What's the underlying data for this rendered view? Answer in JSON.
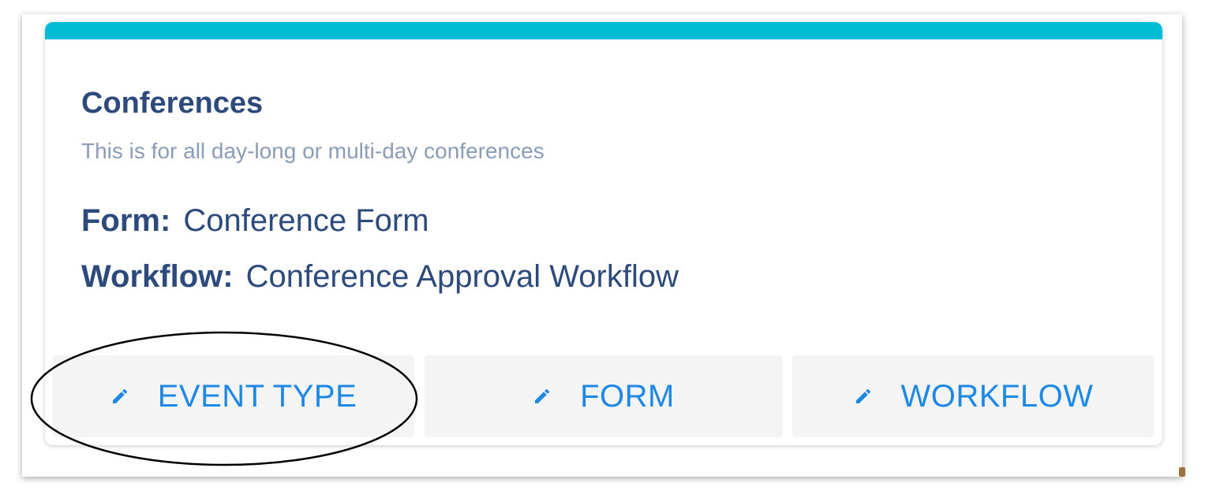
{
  "card": {
    "title": "Conferences",
    "description": "This is for all day-long or multi-day conferences",
    "form_label": "Form:",
    "form_value": "Conference Form",
    "workflow_label": "Workflow:",
    "workflow_value": "Conference Approval Workflow"
  },
  "actions": {
    "event_type_label": "EVENT TYPE",
    "form_label": "FORM",
    "workflow_label": "WORKFLOW",
    "icon": "pencil-icon"
  },
  "colors": {
    "accent_bar": "#00bcd4",
    "title": "#2c4a7c",
    "subtitle": "#8a9cb8",
    "info_text": "#2c4a7c",
    "button_text": "#1e88e5",
    "button_bg": "#f4f4f4",
    "annotation": "#000000"
  }
}
